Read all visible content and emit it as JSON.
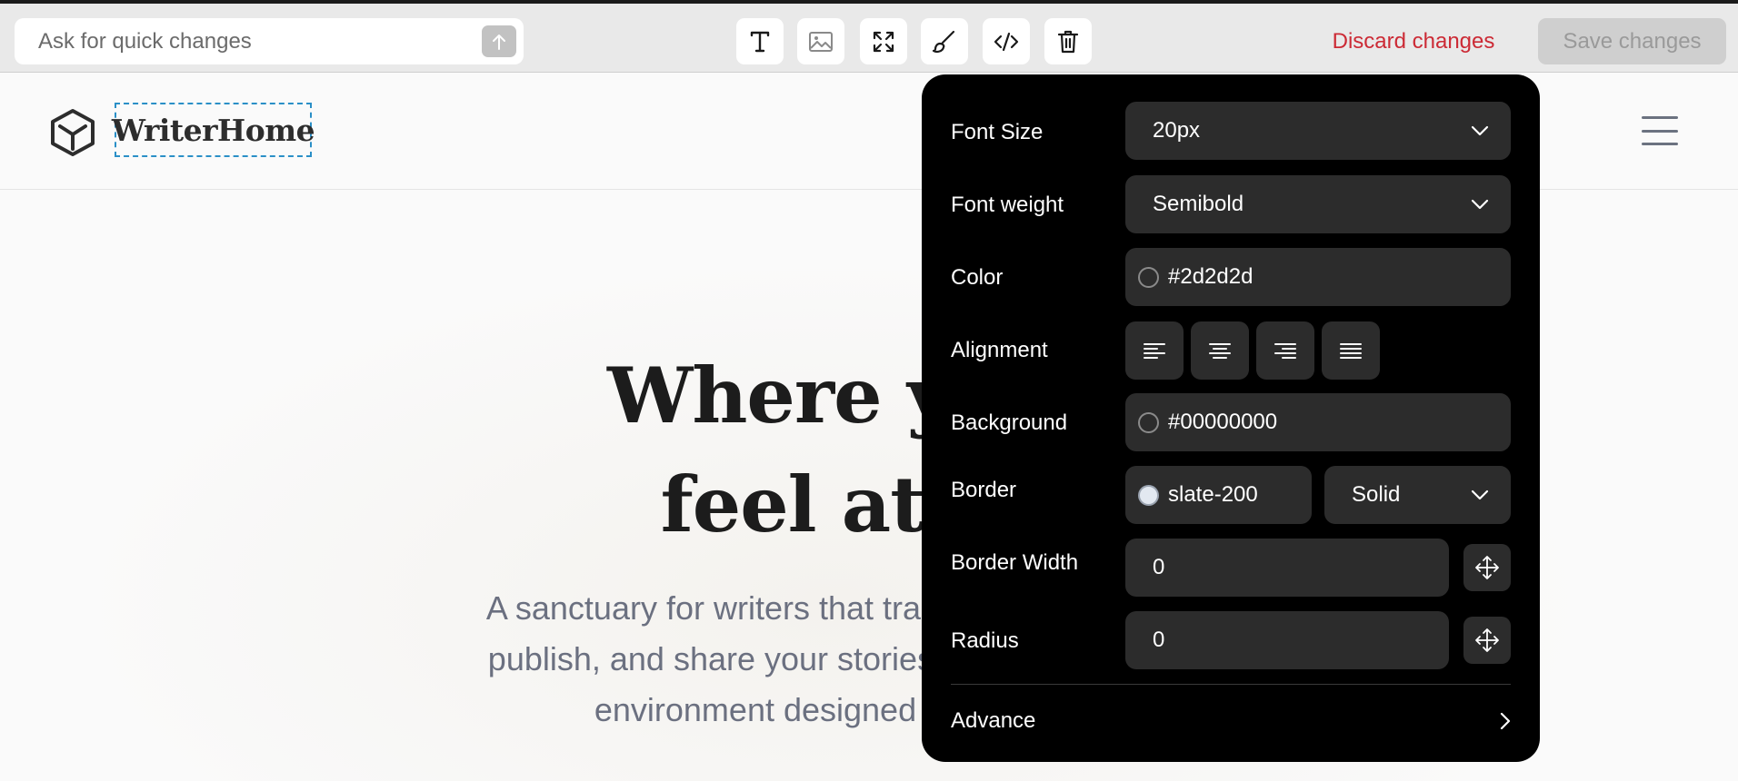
{
  "toolbar": {
    "ask_placeholder": "Ask for quick changes",
    "tools": [
      {
        "name": "text-tool",
        "icon": "text-icon"
      },
      {
        "name": "image-tool",
        "icon": "image-icon"
      },
      {
        "name": "expand-tool",
        "icon": "expand-icon"
      },
      {
        "name": "style-tool",
        "icon": "brush-icon"
      },
      {
        "name": "code-tool",
        "icon": "code-icon"
      },
      {
        "name": "delete-tool",
        "icon": "trash-icon"
      }
    ],
    "discard_label": "Discard changes",
    "save_label": "Save changes"
  },
  "site": {
    "brand": "WriterHome",
    "hero_title_line1": "Where your",
    "hero_title_line2": "feel at h",
    "hero_sub_line1": "A sanctuary for writers that transcends t",
    "hero_sub_line2": "publish, and share your stories in a bea",
    "hero_sub_line3": "environment designed fo"
  },
  "panel": {
    "font_size": {
      "label": "Font Size",
      "value": "20px"
    },
    "font_weight": {
      "label": "Font weight",
      "value": "Semibold"
    },
    "color": {
      "label": "Color",
      "value": "#2d2d2d"
    },
    "alignment": {
      "label": "Alignment",
      "options": [
        "left",
        "center",
        "right",
        "justify"
      ]
    },
    "background": {
      "label": "Background",
      "value": "#00000000"
    },
    "border": {
      "label": "Border",
      "color_value": "slate-200",
      "style_value": "Solid"
    },
    "border_width": {
      "label": "Border Width",
      "value": "0"
    },
    "radius": {
      "label": "Radius",
      "value": "0"
    },
    "advance_label": "Advance"
  },
  "colors": {
    "discard": "#cc2a35",
    "panel_bg": "#000000",
    "field_bg": "#2c2c2c",
    "selection_outline": "#2a8fc7"
  }
}
